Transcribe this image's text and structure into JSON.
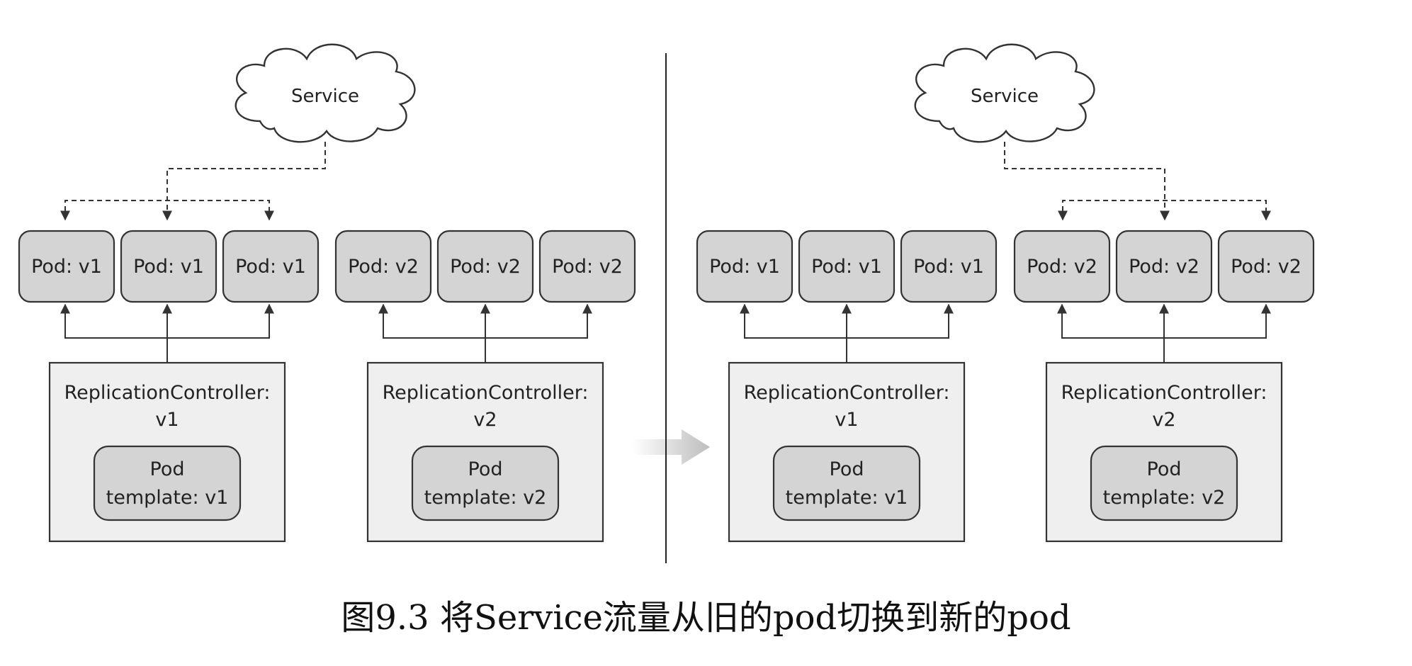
{
  "caption": "图9.3 将Service流量从旧的pod切换到新的pod",
  "panels": [
    {
      "service_label": "Service",
      "v1_pods": [
        "Pod: v1",
        "Pod: v1",
        "Pod: v1"
      ],
      "v2_pods": [
        "Pod: v2",
        "Pod: v2",
        "Pod: v2"
      ],
      "rc_v1": {
        "label": "ReplicationController:",
        "version": "v1",
        "template_line1": "Pod",
        "template_line2": "template: v1"
      },
      "rc_v2": {
        "label": "ReplicationController:",
        "version": "v2",
        "template_line1": "Pod",
        "template_line2": "template: v2"
      }
    },
    {
      "service_label": "Service",
      "v1_pods": [
        "Pod: v1",
        "Pod: v1",
        "Pod: v1"
      ],
      "v2_pods": [
        "Pod: v2",
        "Pod: v2",
        "Pod: v2"
      ],
      "rc_v1": {
        "label": "ReplicationController:",
        "version": "v1",
        "template_line1": "Pod",
        "template_line2": "template: v1"
      },
      "rc_v2": {
        "label": "ReplicationController:",
        "version": "v2",
        "template_line1": "Pod",
        "template_line2": "template: v2"
      }
    }
  ],
  "colors": {
    "pod_fill": "#d4d4d4",
    "rc_fill": "#efefef",
    "template_fill": "#d4d4d4",
    "stroke": "#333333",
    "transition_arrow": "#c4c4c4"
  }
}
